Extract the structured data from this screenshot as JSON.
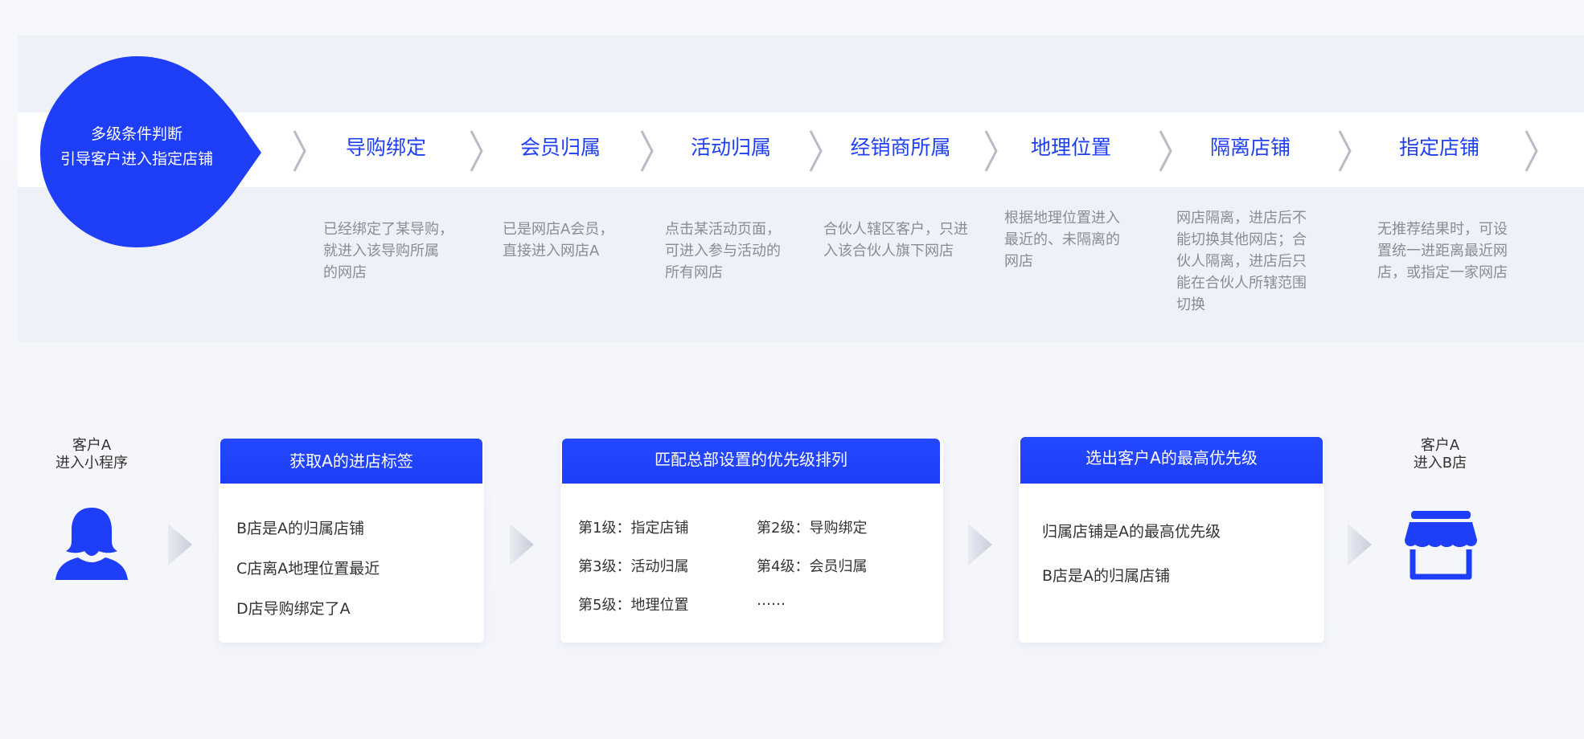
{
  "colors": {
    "accent": "#1f3ff5",
    "badge": "#1e3ef7",
    "desc": "#8a8d93"
  },
  "badge": {
    "line1": "多级条件判断",
    "line2": "引导客户进入指定店铺"
  },
  "steps": [
    {
      "title": "导购绑定",
      "desc": [
        "已经绑定了某导购，",
        "就进入该导购所属",
        "的网店"
      ]
    },
    {
      "title": "会员归属",
      "desc": [
        "已是网店A会员，",
        "直接进入网店A"
      ]
    },
    {
      "title": "活动归属",
      "desc": [
        "点击某活动页面，",
        "可进入参与活动的",
        "所有网店"
      ]
    },
    {
      "title": "经销商所属",
      "desc": [
        "合伙人辖区客户，只进",
        "入该合伙人旗下网店"
      ]
    },
    {
      "title": "地理位置",
      "desc": [
        "根据地理位置进入",
        "最近的、未隔离的",
        "网店"
      ]
    },
    {
      "title": "隔离店铺",
      "desc": [
        "网店隔离，进店后不",
        "能切换其他网店；合",
        "伙人隔离，进店后只",
        "能在合伙人所辖范围",
        "切换"
      ]
    },
    {
      "title": "指定店铺",
      "desc": [
        "无推荐结果时，可设",
        "置统一进距离最近网",
        "店，或指定一家网店"
      ]
    }
  ],
  "flow": {
    "start": {
      "line1": "客户A",
      "line2": "进入小程序",
      "icon": "customer-icon"
    },
    "end": {
      "line1": "客户A",
      "line2": "进入B店",
      "icon": "store-icon"
    },
    "card1": {
      "title": "获取A的进店标签",
      "lines": [
        "B店是A的归属店铺",
        "C店离A地理位置最近",
        "D店导购绑定了A"
      ]
    },
    "card2": {
      "title": "匹配总部设置的优先级排列",
      "lines": [
        "第1级：指定店铺",
        "第2级：导购绑定",
        "第3级：活动归属",
        "第4级：会员归属",
        "第5级：地理位置",
        "……"
      ]
    },
    "card3": {
      "title": "选出客户A的最高优先级",
      "lines": [
        "归属店铺是A的最高优先级",
        "B店是A的归属店铺"
      ]
    }
  }
}
